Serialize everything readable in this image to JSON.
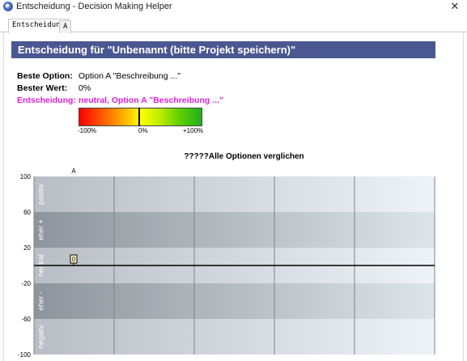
{
  "window": {
    "title": "Entscheidung - Decision Making Helper",
    "close_glyph": "✕"
  },
  "tabs": [
    {
      "label": "Entscheidung",
      "active": true
    },
    {
      "label": "A",
      "active": false
    }
  ],
  "header": {
    "title": "Entscheidung für  \"Unbenannt (bitte Projekt speichern)\""
  },
  "summary": {
    "best_option_label": "Beste Option:",
    "best_option_value": "Option A \"Beschreibung ...\"",
    "best_value_label": "Bester Wert:",
    "best_value_value": "0%",
    "decision_label": "Entscheidung:",
    "decision_value": "neutral, Option A \"Beschreibung ...\"",
    "decision_color": "#e020d8"
  },
  "scale": {
    "min_label": "-100%",
    "mid_label": "0%",
    "max_label": "+100%",
    "marker_value": 0
  },
  "chart_data": {
    "type": "scatter",
    "title": "?????Alle Optionen verglichen",
    "categories": [
      "A"
    ],
    "values": [
      0
    ],
    "data_labels": [
      "0"
    ],
    "ylim": [
      -100,
      100
    ],
    "yticks": [
      100,
      60,
      20,
      -20,
      -60,
      -100
    ],
    "bands": [
      {
        "label": "positiv",
        "from": 60,
        "to": 100
      },
      {
        "label": "eher +",
        "from": 20,
        "to": 60
      },
      {
        "label": "neutral",
        "from": -20,
        "to": 20
      },
      {
        "label": "eher -",
        "from": -60,
        "to": -20
      },
      {
        "label": "negativ",
        "from": -100,
        "to": -60
      }
    ],
    "grid": true,
    "legend": "none"
  }
}
